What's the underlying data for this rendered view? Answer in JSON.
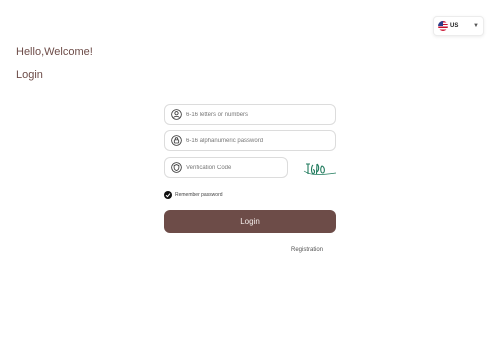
{
  "language_selector": {
    "code": "US"
  },
  "header": {
    "greeting": "Hello,Welcome!",
    "title": "Login"
  },
  "form": {
    "username_placeholder": "6-16 letters or numbers",
    "username_value": "",
    "password_placeholder": "6-16 alphanumeric password",
    "password_value": "",
    "code_placeholder": "Verification Code",
    "code_value": "",
    "remember_label": "Remember password",
    "remember_checked": true,
    "login_label": "Login",
    "register_label": "Registration"
  },
  "colors": {
    "brand": "#6d4c48",
    "captcha_ink": "#1f7a5c"
  },
  "icons": [
    "us-flag-icon",
    "chevron-down-icon",
    "user-icon",
    "lock-icon",
    "shield-icon",
    "check-icon"
  ]
}
